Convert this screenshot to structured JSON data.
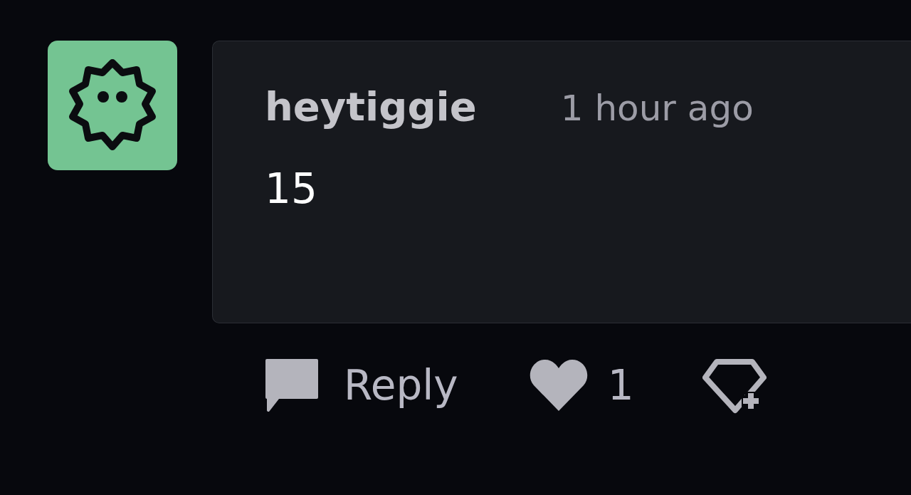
{
  "comment": {
    "author": "heytiggie",
    "time": "1 hour ago",
    "body": "15",
    "actions": {
      "reply": "Reply",
      "like_count": "1"
    }
  }
}
